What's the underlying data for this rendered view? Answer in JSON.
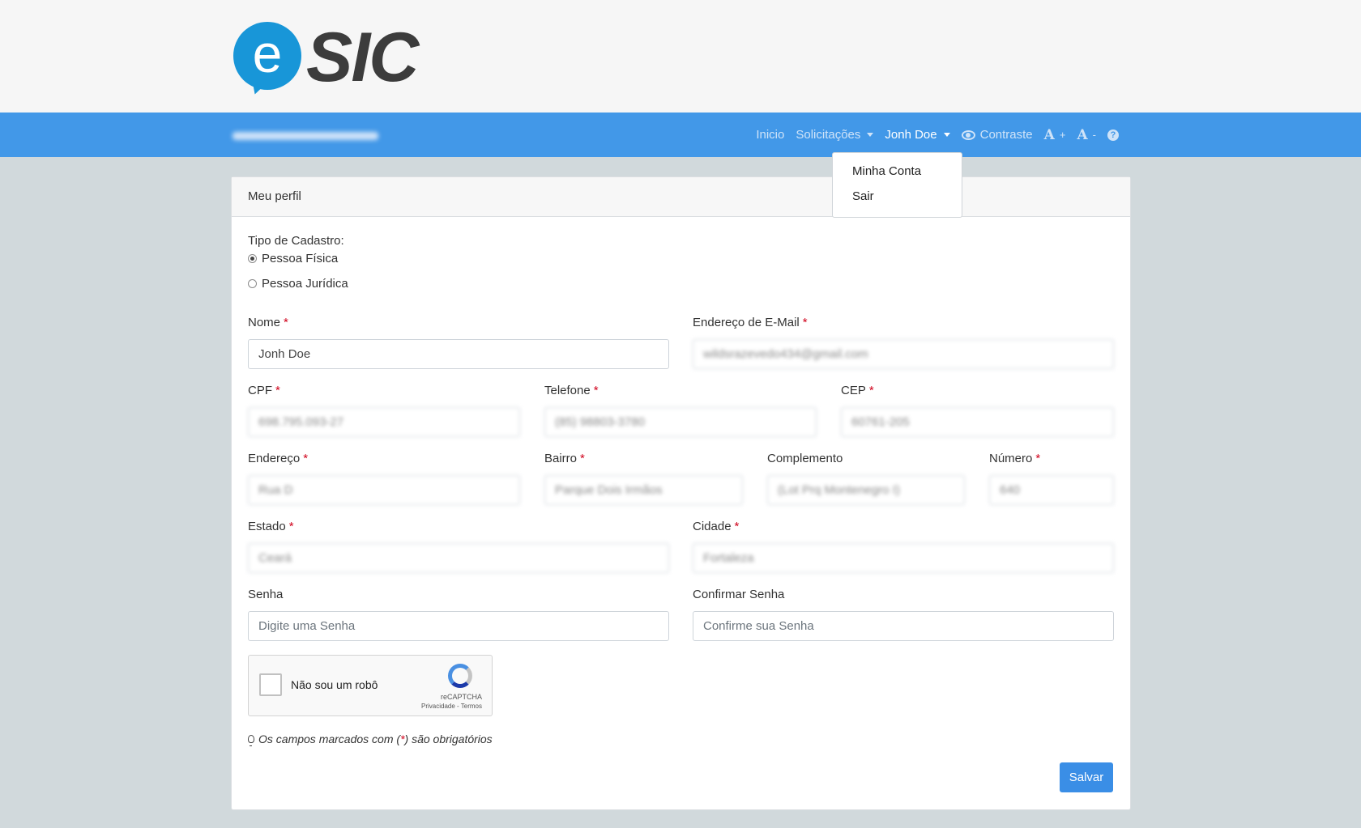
{
  "header": {
    "logo_letter": "e",
    "logo_text": "SIC"
  },
  "navbar": {
    "items": [
      {
        "label": "Inicio"
      },
      {
        "label": "Solicitações"
      },
      {
        "label": "Jonh Doe"
      },
      {
        "label": "Contraste"
      },
      {
        "label": "A",
        "suffix": "+"
      },
      {
        "label": "A",
        "suffix": "-"
      },
      {
        "label": "?"
      }
    ]
  },
  "user_menu": {
    "items": [
      {
        "label": "Minha Conta"
      },
      {
        "label": "Sair"
      }
    ]
  },
  "card": {
    "title": "Meu perfil"
  },
  "form": {
    "tipo_label": "Tipo de Cadastro:",
    "radio_fisica": "Pessoa Física",
    "radio_juridica": "Pessoa Jurídica",
    "required_mark": "*",
    "nome": {
      "label": "Nome",
      "value": "Jonh Doe"
    },
    "email": {
      "label": "Endereço de E-Mail",
      "value": "wildsrazevedo434@gmail.com"
    },
    "cpf": {
      "label": "CPF",
      "value": "698.795.093-27"
    },
    "telefone": {
      "label": "Telefone",
      "value": "(85) 98803-3780"
    },
    "cep": {
      "label": "CEP",
      "value": "60761-205"
    },
    "endereco": {
      "label": "Endereço",
      "value": "Rua D"
    },
    "bairro": {
      "label": "Bairro",
      "value": "Parque Dois Irmãos"
    },
    "complemento": {
      "label": "Complemento",
      "value": "(Lot Prq Montenegro I)"
    },
    "numero": {
      "label": "Número",
      "value": "640"
    },
    "estado": {
      "label": "Estado",
      "value": "Ceará"
    },
    "cidade": {
      "label": "Cidade",
      "value": "Fortaleza"
    },
    "senha": {
      "label": "Senha",
      "placeholder": "Digite uma Senha"
    },
    "confirmar": {
      "label": "Confirmar Senha",
      "placeholder": "Confirme sua Senha"
    }
  },
  "captcha": {
    "label": "Não sou um robô",
    "brand": "reCAPTCHA",
    "links": "Privacidade - Termos"
  },
  "note": {
    "before": "Os campos marcados com (",
    "mark": "*",
    "after": ") são obrigatórios"
  },
  "save_label": "Salvar"
}
